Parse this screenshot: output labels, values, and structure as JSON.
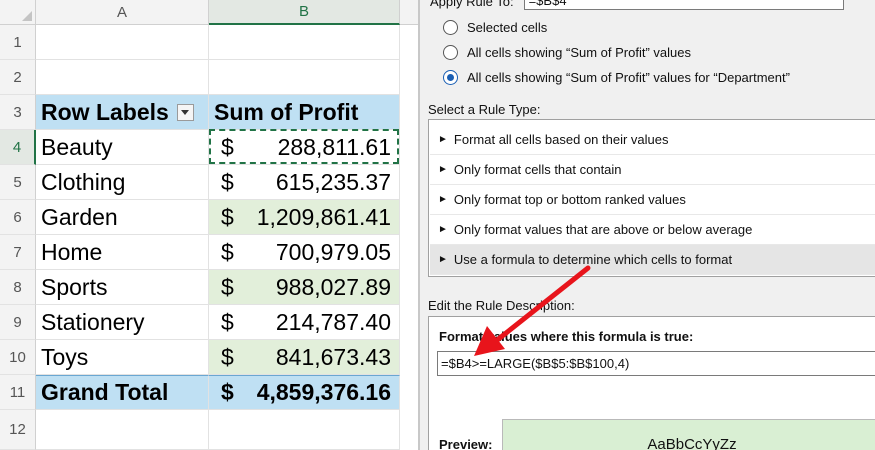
{
  "sheet": {
    "columns": [
      "A",
      "B"
    ],
    "rows": [
      "1",
      "2",
      "3",
      "4",
      "5",
      "6",
      "7",
      "8",
      "9",
      "10",
      "11",
      "12"
    ],
    "header": {
      "row_labels": "Row Labels",
      "sum_of_profit": "Sum of Profit"
    },
    "data": [
      {
        "label": "Beauty",
        "currency": "$",
        "amount": "288,811.61"
      },
      {
        "label": "Clothing",
        "currency": "$",
        "amount": "615,235.37"
      },
      {
        "label": "Garden",
        "currency": "$",
        "amount": "1,209,861.41"
      },
      {
        "label": "Home",
        "currency": "$",
        "amount": "700,979.05"
      },
      {
        "label": "Sports",
        "currency": "$",
        "amount": "988,027.89"
      },
      {
        "label": "Stationery",
        "currency": "$",
        "amount": "214,787.40"
      },
      {
        "label": "Toys",
        "currency": "$",
        "amount": "841,673.43"
      }
    ],
    "total": {
      "label": "Grand Total",
      "currency": "$",
      "amount": "4,859,376.16"
    },
    "colors": {
      "header_fill": "#bfe0f3",
      "highlight_fill": "#e2efda",
      "selection": "#217346"
    }
  },
  "dialog": {
    "apply_rule_to_label": "Apply Rule To:",
    "apply_rule_to_value": "=$B$4",
    "radio_options": [
      {
        "label": "Selected cells",
        "selected": false
      },
      {
        "label": "All cells showing “Sum of Profit” values",
        "selected": false
      },
      {
        "label": "All cells showing “Sum of Profit” values for “Department”",
        "selected": true
      }
    ],
    "rule_type_title": "Select a Rule Type:",
    "rule_types": [
      "Format all cells based on their values",
      "Only format cells that contain",
      "Only format top or bottom ranked values",
      "Only format values that are above or below average",
      "Use a formula to determine which cells to format"
    ],
    "selected_rule_index": 4,
    "rule_arrow_icon": "►",
    "edit_desc_title": "Edit the Rule Description:",
    "format_values_title": "Format values where this formula is true:",
    "formula": "=$B4>=LARGE($B$5:$B$100,4)",
    "preview_label": "Preview:",
    "preview_text": "AaBbCcYyZz",
    "preview_fill": "#d9efd3"
  },
  "annotation": {
    "arrow_color": "#e8141b"
  }
}
